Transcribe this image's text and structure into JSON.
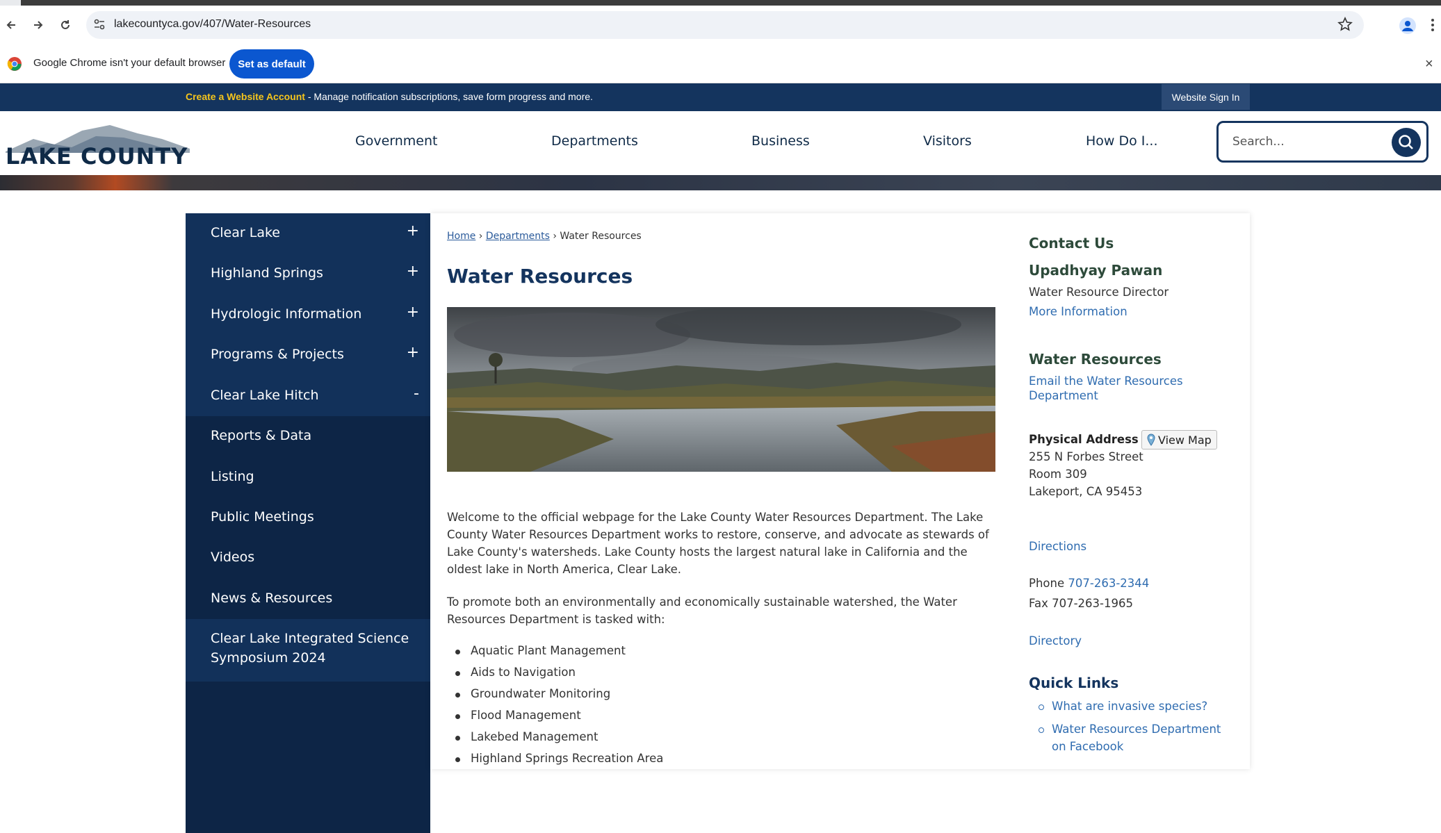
{
  "browser": {
    "url": "lakecountyca.gov/407/Water-Resources",
    "infobar_message": "Google Chrome isn't your default browser",
    "set_default_label": "Set as default",
    "close_glyph": "×"
  },
  "account_bar": {
    "link": "Create a Website Account",
    "text": " - Manage notification subscriptions, save form progress and more.",
    "sign_in": "Website Sign In"
  },
  "header": {
    "logo_text": "LAKE COUNTY",
    "nav": [
      "Government",
      "Departments",
      "Business",
      "Visitors",
      "How Do I..."
    ],
    "search_placeholder": "Search..."
  },
  "sidebar": {
    "items": [
      {
        "label": "Clear Lake",
        "toggle": "+"
      },
      {
        "label": "Highland Springs",
        "toggle": "+"
      },
      {
        "label": "Hydrologic Information",
        "toggle": "+"
      },
      {
        "label": "Programs & Projects",
        "toggle": "+"
      },
      {
        "label": "Clear Lake Hitch",
        "toggle": "-"
      },
      {
        "label": "Reports & Data"
      },
      {
        "label": "Listing"
      },
      {
        "label": "Public Meetings"
      },
      {
        "label": "Videos"
      },
      {
        "label": "News & Resources"
      },
      {
        "label": "Clear Lake Integrated Science Symposium 2024"
      }
    ]
  },
  "main": {
    "breadcrumb": {
      "home": "Home",
      "sep": "›",
      "departments": "Departments",
      "current": "Water Resources"
    },
    "title": "Water Resources",
    "intro_1": "Welcome to the official webpage for the Lake County Water Resources Department. The Lake County Water Resources Department works to restore, conserve, and advocate as stewards of Lake County's watersheds. Lake County hosts the largest natural lake in California and the oldest lake in North America, Clear Lake.",
    "intro_2": "To promote both an environmentally and economically sustainable watershed, the Water Resources Department is tasked with:",
    "tasks": [
      "Aquatic Plant Management",
      "Aids to Navigation",
      "Groundwater Monitoring",
      "Flood Management",
      "Lakebed Management",
      "Highland Springs Recreation Area"
    ]
  },
  "contact": {
    "heading": "Contact Us",
    "name": "Upadhyay Pawan",
    "role": "Water Resource Director",
    "more_info": "More Information",
    "dept_heading": "Water Resources",
    "email_line1": "Email the Water Resources",
    "email_line2": "Department",
    "address_label": "Physical Address",
    "view_map": "View Map",
    "address_1": "255 N Forbes Street",
    "address_2": "Room 309",
    "address_3": "Lakeport, CA 95453",
    "directions": "Directions",
    "phone_label": "Phone",
    "phone": "707-263-2344",
    "fax_label": "Fax",
    "fax": "707-263-1965",
    "directory": "Directory"
  },
  "quick_links": {
    "heading": "Quick Links",
    "items": [
      "What are invasive species?",
      "Water Resources Department on Facebook"
    ]
  }
}
